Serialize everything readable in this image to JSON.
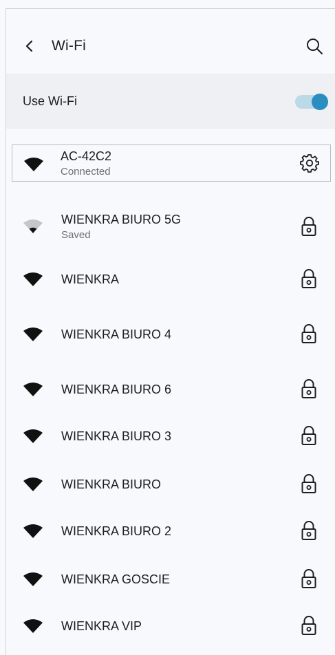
{
  "header": {
    "title": "Wi-Fi",
    "back_icon": "back-arrow-icon",
    "search_icon": "search-icon"
  },
  "use_wifi": {
    "label": "Use Wi-Fi",
    "enabled": true,
    "accent": "#2a8ec1"
  },
  "connected_network": {
    "name": "AC-42C2",
    "status": "Connected",
    "action_icon": "gear-icon"
  },
  "networks": [
    {
      "name": "WIENKRA BIURO 5G",
      "status": "Saved",
      "signal": "weak",
      "secured": true
    },
    {
      "name": "WIENKRA",
      "status": "",
      "signal": "full",
      "secured": true
    },
    {
      "name": "WIENKRA BIURO 4",
      "status": "",
      "signal": "full",
      "secured": true
    },
    {
      "name": "WIENKRA BIURO 6",
      "status": "",
      "signal": "full",
      "secured": true
    },
    {
      "name": "WIENKRA BIURO 3",
      "status": "",
      "signal": "full",
      "secured": true
    },
    {
      "name": "WIENKRA BIURO",
      "status": "",
      "signal": "full",
      "secured": true
    },
    {
      "name": "WIENKRA BIURO 2",
      "status": "",
      "signal": "full",
      "secured": true
    },
    {
      "name": "WIENKRA GOSCIE",
      "status": "",
      "signal": "full",
      "secured": true
    },
    {
      "name": "WIENKRA VIP",
      "status": "",
      "signal": "full",
      "secured": true
    }
  ]
}
